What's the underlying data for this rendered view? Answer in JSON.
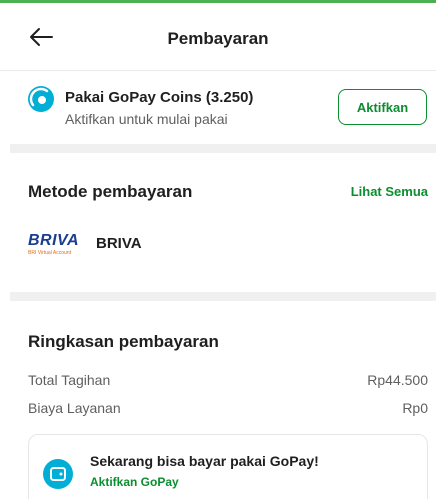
{
  "header": {
    "title": "Pembayaran"
  },
  "coins": {
    "title": "Pakai GoPay Coins (3.250)",
    "subtitle": "Aktifkan untuk mulai pakai",
    "button_label": "Aktifkan"
  },
  "payment_method": {
    "title": "Metode pembayaran",
    "see_all_label": "Lihat Semua",
    "selected": {
      "logo_text": "BRIVA",
      "logo_subtext": "BRI Virtual Account",
      "name": "BRIVA"
    }
  },
  "summary": {
    "title": "Ringkasan pembayaran",
    "rows": [
      {
        "label": "Total Tagihan",
        "value": "Rp44.500"
      },
      {
        "label": "Biaya Layanan",
        "value": "Rp0"
      }
    ]
  },
  "gopay_promo": {
    "title": "Sekarang bisa bayar pakai GoPay!",
    "link_label": "Aktifkan GoPay"
  },
  "colors": {
    "accent": "#0a8e2f",
    "coin_blue": "#00aed6",
    "briva_blue": "#1a3d8f"
  }
}
